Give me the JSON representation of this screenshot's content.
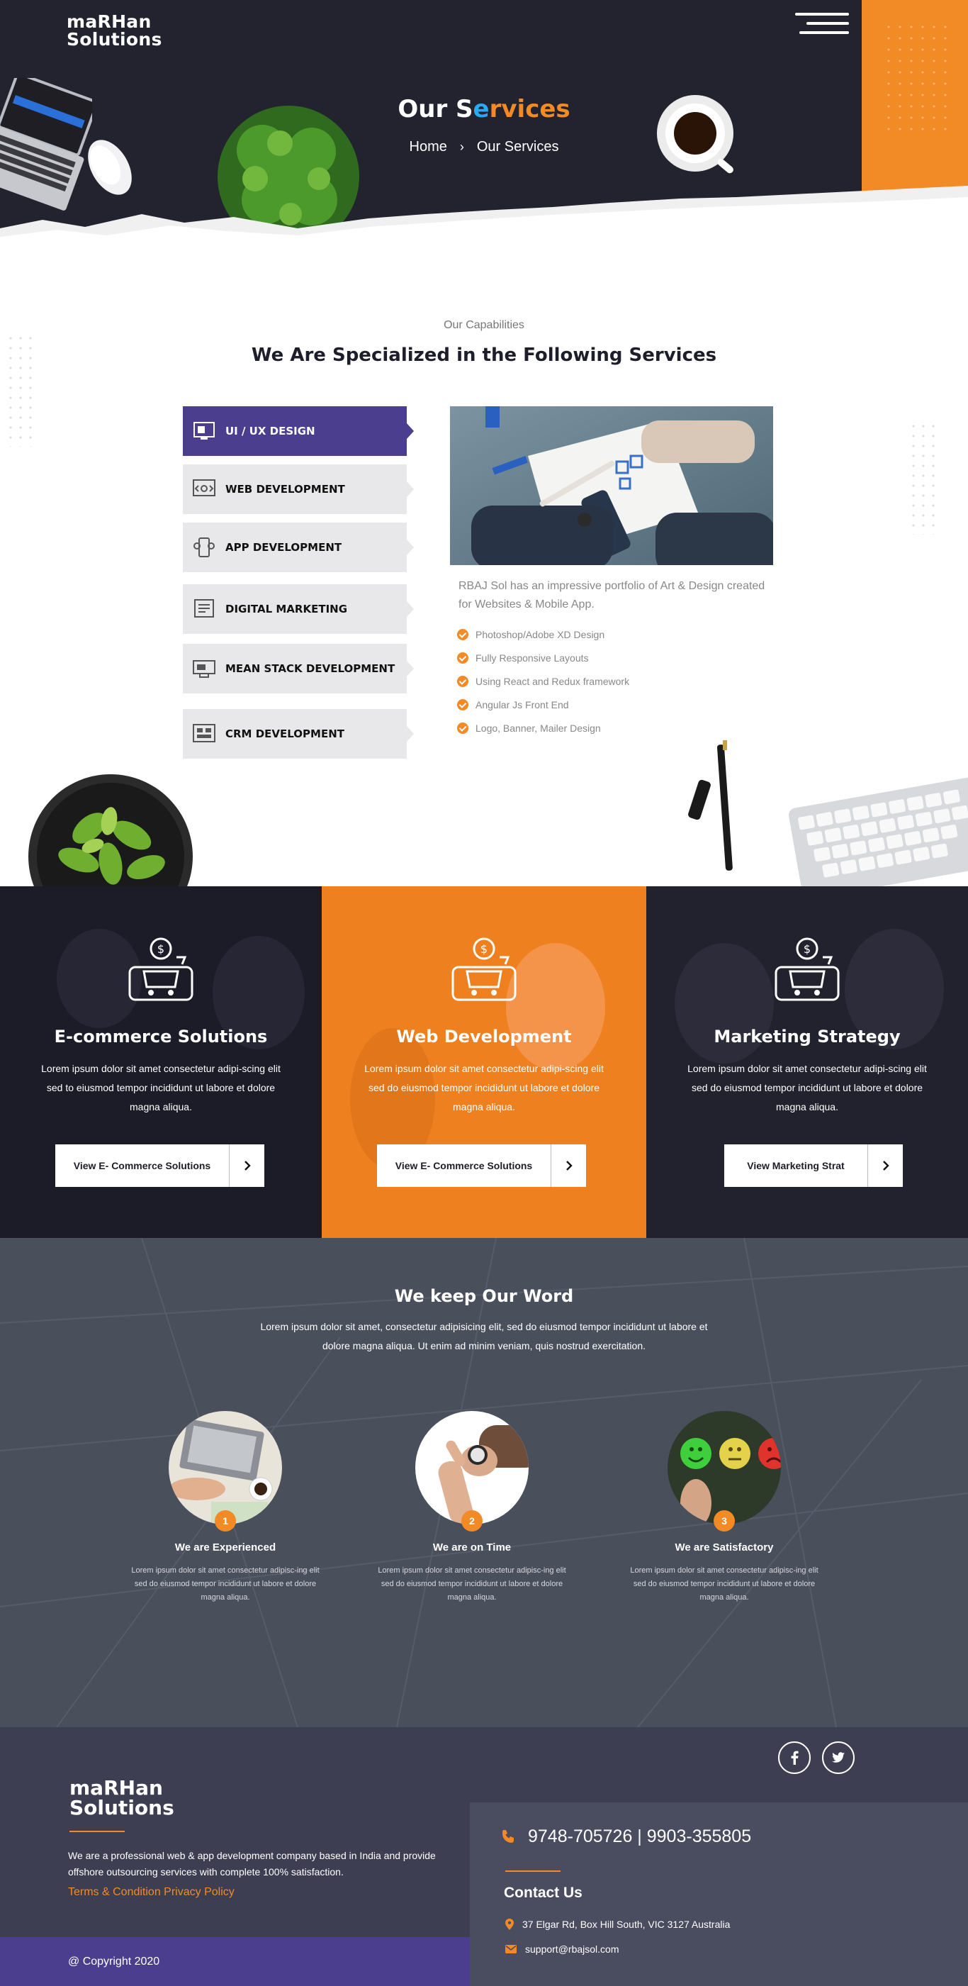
{
  "brand": {
    "logo_line1": "maRHan",
    "logo_line2": "Solutions"
  },
  "hero": {
    "title_part1": "Our S",
    "title_part2": "e",
    "title_part3": "rvi",
    "title_part4": "ces",
    "breadcrumb": [
      "Home",
      "Our Services"
    ]
  },
  "capabilities": {
    "subtitle": "Our Capabilities",
    "title": "We Are Specialized in the Following Services",
    "tabs": [
      {
        "label": "UI / UX DESIGN",
        "icon": "monitor-icon",
        "active": true
      },
      {
        "label": "WEB DEVELOPMENT",
        "icon": "web-code-icon",
        "active": false
      },
      {
        "label": "APP DEVELOPMENT",
        "icon": "mobile-app-icon",
        "active": false
      },
      {
        "label": "DIGITAL MARKETING",
        "icon": "marketing-icon",
        "active": false
      },
      {
        "label": "MEAN STACK DEVELOPMENT",
        "icon": "stack-icon",
        "active": false
      },
      {
        "label": "CRM DEVELOPMENT",
        "icon": "crm-icon",
        "active": false
      }
    ],
    "description": "RBAJ Sol has an impressive portfolio of Art & Design created for Websites & Mobile App.",
    "features": [
      "Photoshop/Adobe XD Design",
      "Fully Responsive Layouts",
      "Using React and Redux framework",
      "Angular Js Front End",
      "Logo, Banner, Mailer Design"
    ]
  },
  "solutions": [
    {
      "title": "E-commerce Solutions",
      "text": "Lorem ipsum dolor sit amet consectetur adipi-scing elit sed to eiusmod tempor incididunt ut labore et dolore magna aliqua.",
      "button": "View E- Commerce Solutions",
      "bg": "#1c1c28"
    },
    {
      "title": "Web Development",
      "text": "Lorem ipsum dolor sit amet consectetur adipi-scing elit sed do eiusmod tempor incididunt ut labore et dolore magna aliqua.",
      "button": "View E- Commerce Solutions",
      "bg": "#ef8020"
    },
    {
      "title": "Marketing Strategy",
      "text": "Lorem ipsum dolor sit amet consectetur adipi-scing elit sed do eiusmod tempor incididunt ut labore et dolore magna aliqua.",
      "button": "View Marketing Strat",
      "bg": "#22222e"
    }
  ],
  "keep_word": {
    "title": "We keep Our Word",
    "text": "Lorem ipsum dolor sit amet, consectetur adipisicing elit, sed do eiusmod tempor incididunt ut labore et dolore magna aliqua. Ut enim ad minim veniam, quis nostrud exercitation.",
    "items": [
      {
        "number": "1",
        "title": "We are Experienced",
        "text": "Lorem ipsum dolor sit amet consectetur adipisc-ing elit sed do eiusmod tempor incididunt ut labore et dolore magna aliqua."
      },
      {
        "number": "2",
        "title": "We are on Time",
        "text": "Lorem ipsum dolor sit amet consectetur adipisc-ing elit sed do eiusmod tempor incididunt ut labore et dolore magna aliqua."
      },
      {
        "number": "3",
        "title": "We are Satisfactory",
        "text": "Lorem ipsum dolor sit amet consectetur adipisc-ing elit sed do eiusmod tempor incididunt ut labore et dolore magna aliqua."
      }
    ]
  },
  "footer": {
    "logo_line1": "maRHan",
    "logo_line2": "Solutions",
    "about": "We are a professional web & app development company based in India and provide offshore outsourcing services with complete 100% satisfaction.",
    "link_terms": "Terms & Condition",
    "link_privacy": "Privacy Policy",
    "copyright": "@ Copyright 2020",
    "phone": "9748-705726 | 9903-355805",
    "contact_title": "Contact Us",
    "address": "37 Elgar Rd, Box Hill South, VIC 3127 Australia",
    "email": "support@rbajsol.com",
    "social": [
      "facebook-icon",
      "twitter-icon"
    ]
  },
  "colors": {
    "accent": "#f28a25",
    "purple": "#4b3e8e",
    "dark": "#23232f"
  }
}
